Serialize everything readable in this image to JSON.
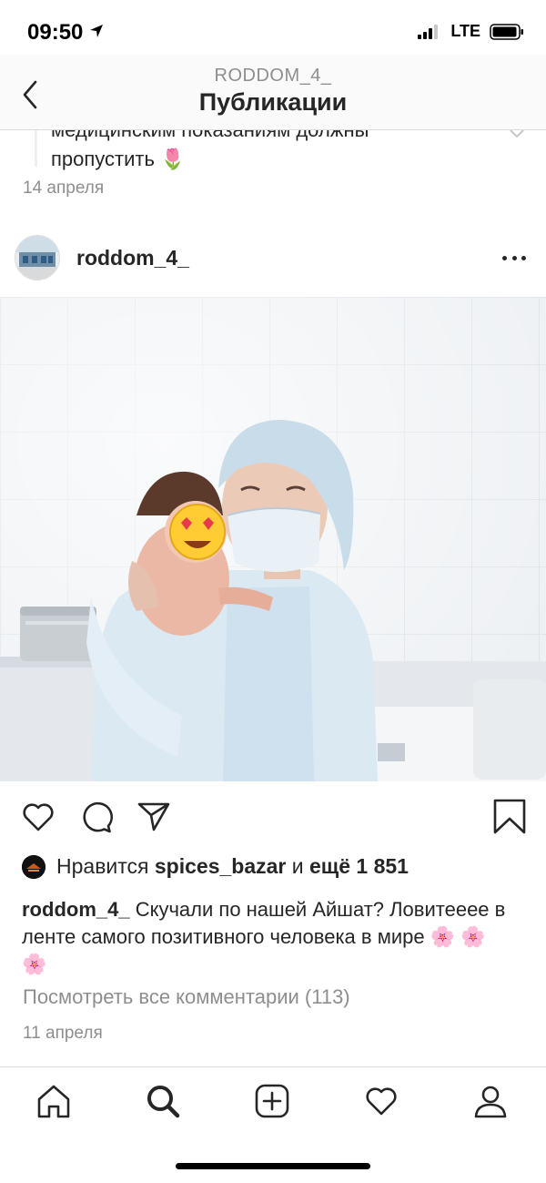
{
  "status_bar": {
    "time": "09:50",
    "network": "LTE"
  },
  "header": {
    "account": "RODDOM_4_",
    "title": "Публикации"
  },
  "previous_post": {
    "caption_tail_line1": "медицинским показаниям должны",
    "caption_tail_line2": "пропустить 🌷",
    "date": "14 апреля"
  },
  "post": {
    "username": "roddom_4_",
    "likes": {
      "prefix": "Нравится ",
      "user": "spices_bazar",
      "middle": " и ",
      "others": "ещё 1 851"
    },
    "caption": {
      "username": "roddom_4_",
      "text": " Скучали по нашей Айшат? Ловитееее в ленте  самого позитивного человека в мире 🌸 🌸 🌸"
    },
    "view_comments": "Посмотреть все комментарии (113)",
    "date": "11 апреля"
  },
  "icons": {
    "back": "chevron-left-icon",
    "more": "more-horizontal-icon",
    "like": "heart-icon",
    "comment": "comment-icon",
    "share": "paper-plane-icon",
    "save": "bookmark-icon"
  },
  "tabs": [
    "home",
    "search",
    "add",
    "activity",
    "profile"
  ],
  "colors": {
    "text": "#262626",
    "secondary": "#8e8e8e",
    "border": "#dbdbdb",
    "header_bg": "#fafafa"
  }
}
